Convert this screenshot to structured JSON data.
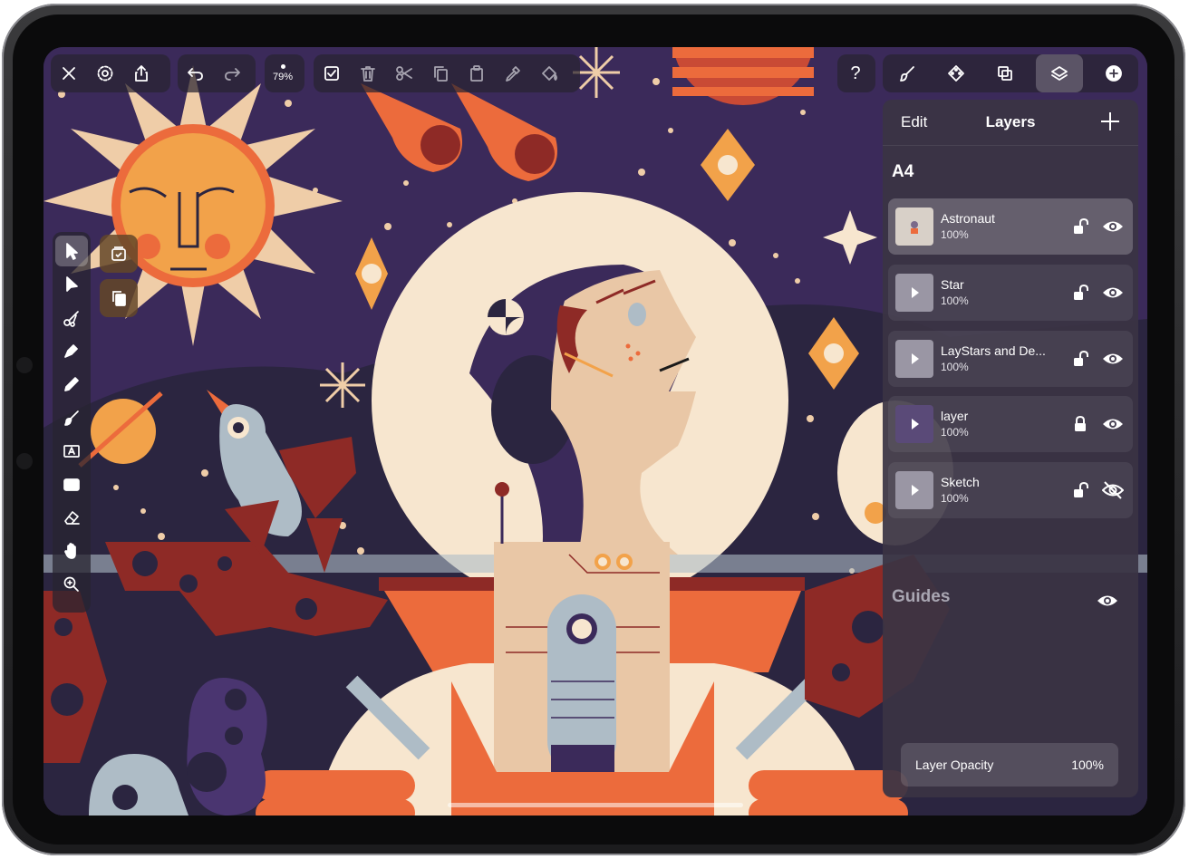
{
  "toolbar": {
    "zoom_label": "79%",
    "left_icons": [
      "close-icon",
      "settings-icon",
      "share-icon"
    ],
    "edit_icons": [
      "select-all-icon",
      "delete-icon",
      "scissors-icon",
      "copy-icon",
      "paste-icon",
      "eyedropper-icon",
      "fill-icon"
    ],
    "help_label": "?",
    "right_icons": [
      "brush-icon",
      "style-icon",
      "boolean-icon",
      "layers-icon",
      "add-icon"
    ]
  },
  "tools": [
    "select-arrow-icon",
    "direct-select-icon",
    "scissors-icon",
    "pen-icon",
    "pencil-icon",
    "brush-icon",
    "text-icon",
    "rectangle-icon",
    "eraser-icon",
    "hand-icon",
    "zoom-icon"
  ],
  "subtools": [
    "select-all-icon",
    "duplicate-icon"
  ],
  "layers_panel": {
    "edit_label": "Edit",
    "title": "Layers",
    "artboard_name": "A4",
    "layers": [
      {
        "name": "Astronaut",
        "opacity": "100%",
        "locked": false,
        "visible": true,
        "selected": true
      },
      {
        "name": "Star",
        "opacity": "100%",
        "locked": false,
        "visible": true,
        "selected": false
      },
      {
        "name": "LayStars and De...",
        "opacity": "100%",
        "locked": false,
        "visible": true,
        "selected": false
      },
      {
        "name": "layer",
        "opacity": "100%",
        "locked": true,
        "visible": true,
        "selected": false
      },
      {
        "name": "Sketch",
        "opacity": "100%",
        "locked": false,
        "visible": false,
        "selected": false
      }
    ],
    "guides_label": "Guides",
    "opacity_label": "Layer Opacity",
    "opacity_value": "100%"
  },
  "colors": {
    "sky": "#3b2a5a",
    "deep_navy": "#2b2540",
    "orange": "#ec6b3c",
    "sun": "#f2a24a",
    "cream": "#f7e6cf",
    "skin": "#e9c7a6",
    "maroon": "#8e2a26",
    "grey_blue": "#aebcc6",
    "star": "#efcda8"
  }
}
